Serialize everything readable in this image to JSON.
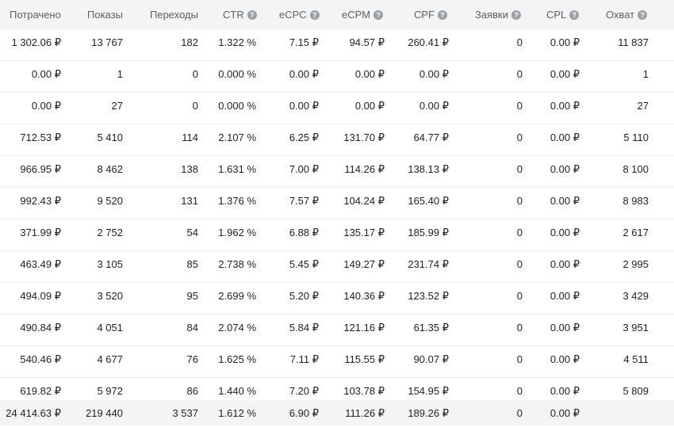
{
  "columns": [
    {
      "label": "Потрачено",
      "help": false
    },
    {
      "label": "Показы",
      "help": false
    },
    {
      "label": "Переходы",
      "help": false
    },
    {
      "label": "CTR",
      "help": true
    },
    {
      "label": "eCPC",
      "help": true
    },
    {
      "label": "eCPM",
      "help": true
    },
    {
      "label": "CPF",
      "help": true
    },
    {
      "label": "Заявки",
      "help": true
    },
    {
      "label": "CPL",
      "help": true
    },
    {
      "label": "Охват",
      "help": true
    }
  ],
  "rows": [
    [
      "1 302.06 ₽",
      "13 767",
      "182",
      "1.322 %",
      "7.15 ₽",
      "94.57 ₽",
      "260.41 ₽",
      "0",
      "0.00 ₽",
      "11 837"
    ],
    [
      "0.00 ₽",
      "1",
      "0",
      "0.000 %",
      "0.00 ₽",
      "0.00 ₽",
      "0.00 ₽",
      "0",
      "0.00 ₽",
      "1"
    ],
    [
      "0.00 ₽",
      "27",
      "0",
      "0.000 %",
      "0.00 ₽",
      "0.00 ₽",
      "0.00 ₽",
      "0",
      "0.00 ₽",
      "27"
    ],
    [
      "712.53 ₽",
      "5 410",
      "114",
      "2.107 %",
      "6.25 ₽",
      "131.70 ₽",
      "64.77 ₽",
      "0",
      "0.00 ₽",
      "5 110"
    ],
    [
      "966.95 ₽",
      "8 462",
      "138",
      "1.631 %",
      "7.00 ₽",
      "114.26 ₽",
      "138.13 ₽",
      "0",
      "0.00 ₽",
      "8 100"
    ],
    [
      "992.43 ₽",
      "9 520",
      "131",
      "1.376 %",
      "7.57 ₽",
      "104.24 ₽",
      "165.40 ₽",
      "0",
      "0.00 ₽",
      "8 983"
    ],
    [
      "371.99 ₽",
      "2 752",
      "54",
      "1.962 %",
      "6.88 ₽",
      "135.17 ₽",
      "185.99 ₽",
      "0",
      "0.00 ₽",
      "2 617"
    ],
    [
      "463.49 ₽",
      "3 105",
      "85",
      "2.738 %",
      "5.45 ₽",
      "149.27 ₽",
      "231.74 ₽",
      "0",
      "0.00 ₽",
      "2 995"
    ],
    [
      "494.09 ₽",
      "3 520",
      "95",
      "2.699 %",
      "5.20 ₽",
      "140.36 ₽",
      "123.52 ₽",
      "0",
      "0.00 ₽",
      "3 429"
    ],
    [
      "490.84 ₽",
      "4 051",
      "84",
      "2.074 %",
      "5.84 ₽",
      "121.16 ₽",
      "61.35 ₽",
      "0",
      "0.00 ₽",
      "3 951"
    ],
    [
      "540.46 ₽",
      "4 677",
      "76",
      "1.625 %",
      "7.11 ₽",
      "115.55 ₽",
      "90.07 ₽",
      "0",
      "0.00 ₽",
      "4 511"
    ],
    [
      "619.82 ₽",
      "5 972",
      "86",
      "1.440 %",
      "7.20 ₽",
      "103.78 ₽",
      "154.95 ₽",
      "0",
      "0.00 ₽",
      "5 809"
    ]
  ],
  "totals": [
    "24 414.63 ₽",
    "219 440",
    "3 537",
    "1.612 %",
    "6.90 ₽",
    "111.26 ₽",
    "189.26 ₽",
    "0",
    "0.00 ₽",
    ""
  ]
}
